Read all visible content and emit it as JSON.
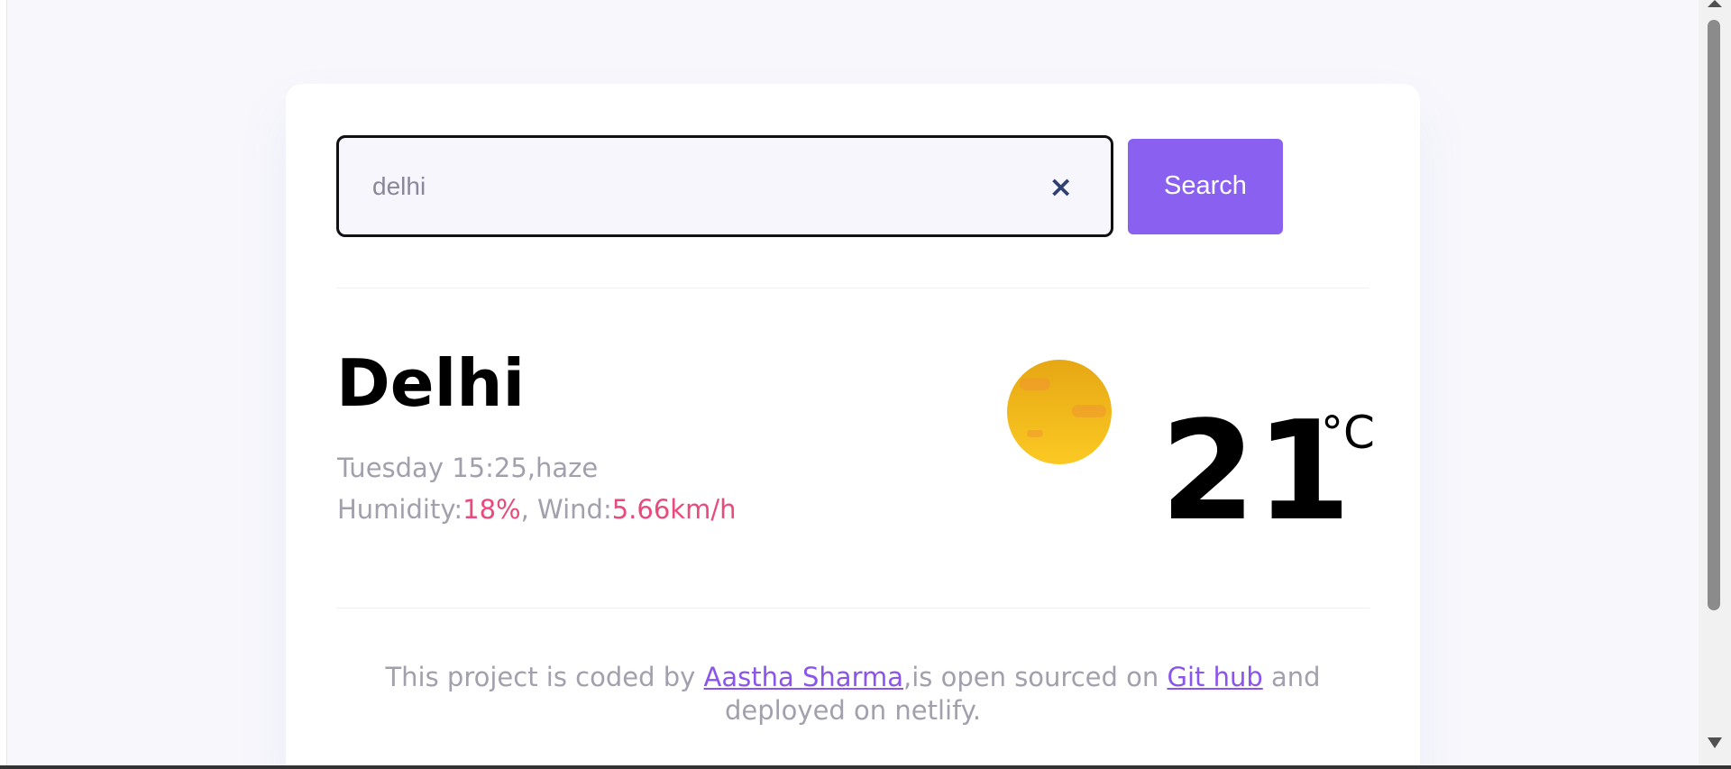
{
  "search": {
    "value": "delhi",
    "clear_icon": "×",
    "button_label": "Search"
  },
  "weather": {
    "city": "Delhi",
    "date_time": "Tuesday 15:25",
    "condition": "haze",
    "humidity_label": "Humidity:",
    "humidity_value": "18%",
    "wind_label": ", Wind:",
    "wind_value": "5.66km/h",
    "temperature": "21",
    "unit": "°C",
    "icon": "haze-sun-icon"
  },
  "footer": {
    "text_1": "This project is coded by ",
    "author_link": "Aastha Sharma",
    "text_2": ",is open sourced on ",
    "github_link": "Git hub",
    "text_3": " and deployed on netlify."
  },
  "colors": {
    "accent": "#8a60f1",
    "highlight": "#e94a7c",
    "link": "#8a55ea",
    "muted_text": "#a39fad"
  }
}
